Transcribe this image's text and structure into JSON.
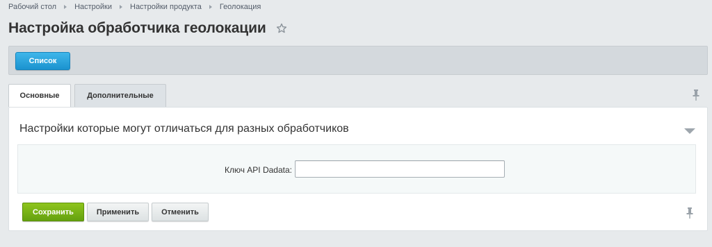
{
  "breadcrumb": {
    "items": [
      "Рабочий стол",
      "Настройки",
      "Настройки продукта",
      "Геолокация"
    ]
  },
  "page": {
    "title": "Настройка обработчика геолокации"
  },
  "toolbar": {
    "list_label": "Список"
  },
  "tabs": [
    {
      "label": "Основные",
      "active": false
    },
    {
      "label": "Дополнительные",
      "active": true
    }
  ],
  "section": {
    "title": "Настройки которые могут отличаться для разных обработчиков",
    "fields": [
      {
        "label": "Ключ API Dadata:",
        "value": "",
        "placeholder": ""
      }
    ]
  },
  "actions": {
    "save_label": "Сохранить",
    "apply_label": "Применить",
    "cancel_label": "Отменить"
  },
  "icons": {
    "favorite": "star-icon",
    "pin": "pin-icon",
    "collapse": "chevron-down-icon"
  },
  "colors": {
    "accent_blue": "#1b93cf",
    "save_green": "#64a10f",
    "background": "#e7eaec"
  }
}
